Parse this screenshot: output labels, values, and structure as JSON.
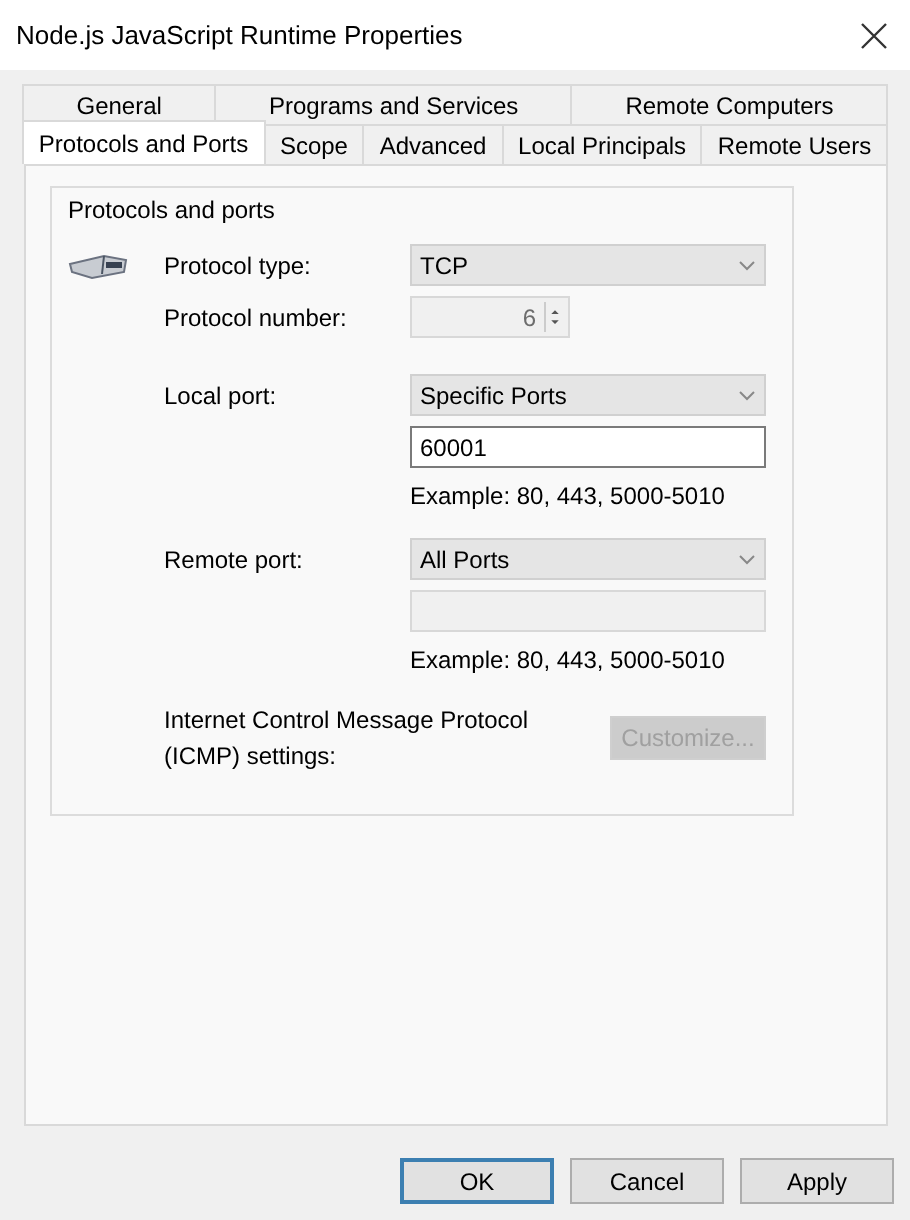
{
  "window": {
    "title": "Node.js JavaScript Runtime Properties"
  },
  "tab_rows": [
    {
      "tabs": [
        {
          "label": "General",
          "selected": false
        },
        {
          "label": "Programs and Services",
          "selected": false
        },
        {
          "label": "Remote Computers",
          "selected": false
        }
      ]
    },
    {
      "tabs": [
        {
          "label": "Protocols and Ports",
          "selected": true
        },
        {
          "label": "Scope",
          "selected": false
        },
        {
          "label": "Advanced",
          "selected": false
        },
        {
          "label": "Local Principals",
          "selected": false
        },
        {
          "label": "Remote Users",
          "selected": false
        }
      ]
    }
  ],
  "group": {
    "title": "Protocols and ports",
    "sections": [
      {
        "items": [
          {
            "kind": "select",
            "label": "Protocol type:",
            "value": "TCP"
          },
          {
            "kind": "spinner",
            "label": "Protocol number:",
            "value": "6",
            "disabled": true
          }
        ]
      },
      {
        "items": [
          {
            "kind": "select",
            "label": "Local port:",
            "value": "Specific Ports"
          },
          {
            "kind": "input",
            "value": "60001",
            "disabled": false
          },
          {
            "kind": "hint",
            "text": "Example: 80, 443, 5000-5010"
          }
        ]
      },
      {
        "items": [
          {
            "kind": "select",
            "label": "Remote port:",
            "value": "All Ports"
          },
          {
            "kind": "input",
            "disabled": true
          },
          {
            "kind": "hint",
            "text": "Example: 80, 443, 5000-5010"
          }
        ]
      },
      {
        "items": [
          {
            "kind": "button",
            "label": "Internet Control Message Protocol (ICMP) settings:",
            "text": "Customize...",
            "disabled": true
          }
        ]
      }
    ]
  },
  "buttons": [
    {
      "label": "OK",
      "default": true
    },
    {
      "label": "Cancel",
      "default": false
    },
    {
      "label": "Apply",
      "default": false
    }
  ]
}
